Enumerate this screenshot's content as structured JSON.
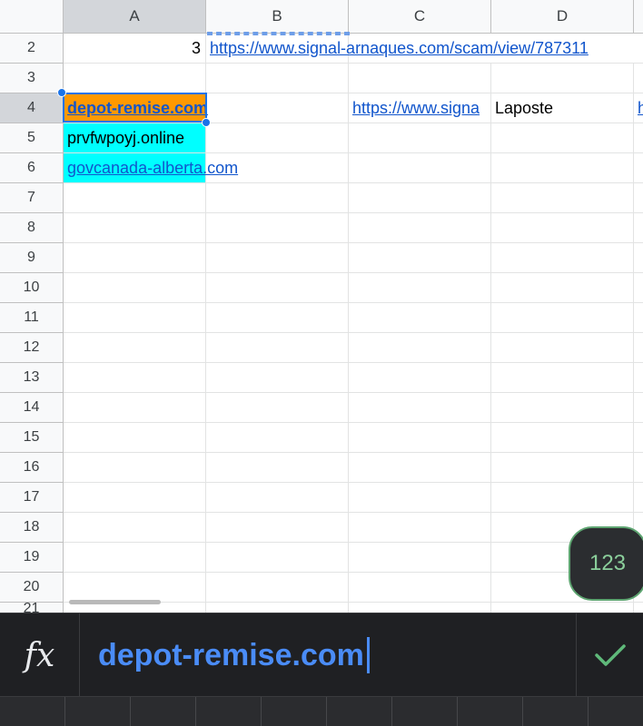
{
  "columns": [
    "A",
    "B",
    "C",
    "D"
  ],
  "rows": [
    "2",
    "3",
    "4",
    "5",
    "6",
    "7",
    "8",
    "9",
    "10",
    "11",
    "12",
    "13",
    "14",
    "15",
    "16",
    "17",
    "18",
    "19",
    "20",
    "21"
  ],
  "active_column": "A",
  "active_row": "4",
  "cells": {
    "A2": "3",
    "B2": "https://www.signal-arnaques.com/scam/view/787311",
    "A4": "depot-remise.com",
    "C4": "https://www.signa",
    "D4": "Laposte",
    "E4": "h",
    "A5": "prvfwpoyj.online",
    "A6": "govcanada-alberta.com"
  },
  "fab_label": "123",
  "formula": {
    "fx_label": "fx",
    "value": "depot-remise.com"
  },
  "colors": {
    "highlight_orange": "#ff9900",
    "highlight_cyan": "#00ffff",
    "link_blue": "#1155cc",
    "selection_blue": "#1a73e8",
    "formula_text": "#4a8cf7",
    "confirm_green": "#5fb97a"
  }
}
